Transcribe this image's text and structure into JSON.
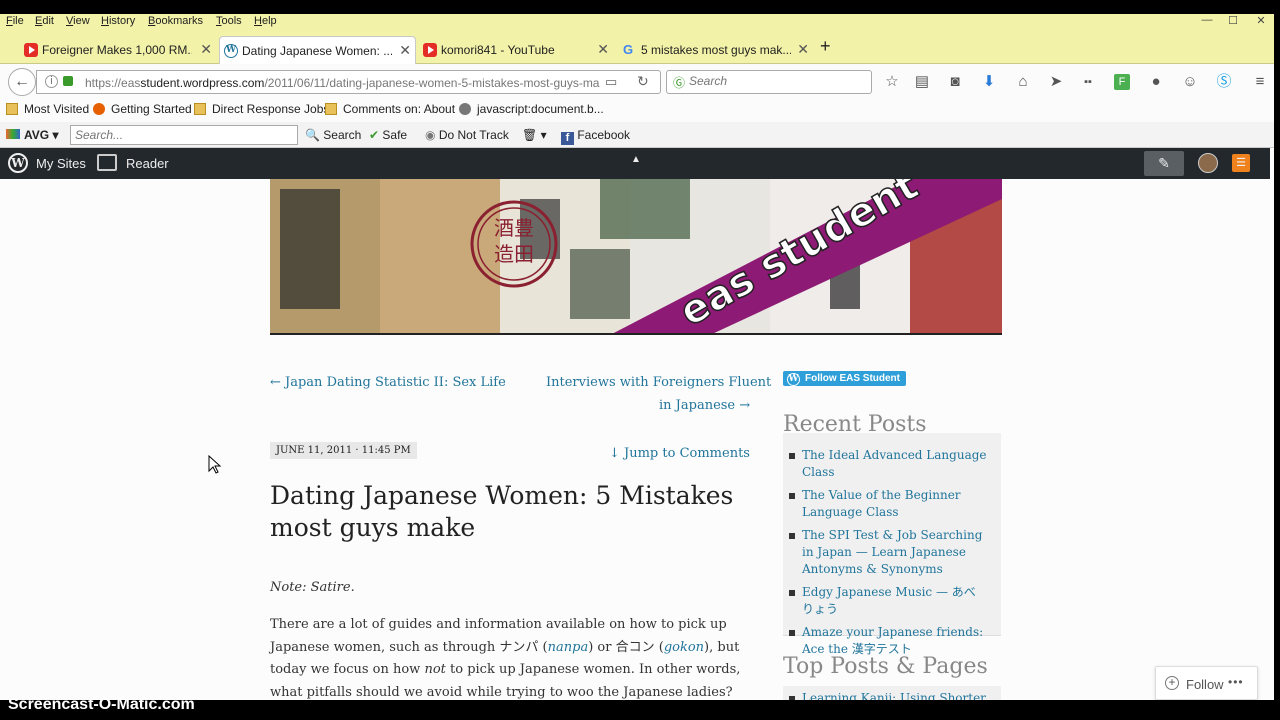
{
  "menu": [
    "File",
    "Edit",
    "View",
    "History",
    "Bookmarks",
    "Tools",
    "Help"
  ],
  "tabs": [
    {
      "label": "Foreigner Makes 1,000 RM...",
      "icon": "youtube-icon"
    },
    {
      "label": "Dating Japanese Women: ...",
      "icon": "wordpress-icon"
    },
    {
      "label": "komori841 - YouTube",
      "icon": "youtube-icon"
    },
    {
      "label": "5 mistakes most guys mak...",
      "icon": "google-icon"
    }
  ],
  "url": {
    "prefix": "https://eas",
    "domain": "student.wordpress.com",
    "path": "/2011/06/11/dating-japanese-women-5-mistakes-most-guys-ma"
  },
  "search_placeholder": "Search",
  "bookmarks": [
    "Most Visited",
    "Getting Started",
    "Direct Response Jobs",
    "Comments on: About",
    "javascript:document.b..."
  ],
  "avg": {
    "brand": "AVG",
    "search_placeholder": "Search...",
    "search_label": "Search",
    "safe": "Safe",
    "dnt": "Do Not Track",
    "facebook": "Facebook"
  },
  "wp_admin": {
    "my_sites": "My Sites",
    "reader": "Reader"
  },
  "header_banner": {
    "text": "eas student",
    "seal": "酒豊造田"
  },
  "post_nav": {
    "prev": "← Japan Dating Statistic II: Sex Life",
    "next_line1": "Interviews with Foreigners Fluent",
    "next_line2": "in Japanese →"
  },
  "post": {
    "date": "JUNE 11, 2011 · 11:45 PM",
    "jump": "↓ Jump to Comments",
    "title": "Dating Japanese Women: 5 Mistakes most guys make",
    "note": "Note: Satire.",
    "p1": "There are a lot of guides and information available on how to pick up Japanese women, such as through ナンパ (",
    "link1": "nanpa",
    "p2": ") or 合コン (",
    "link2": "gokon",
    "p3": "), but today we focus on how ",
    "em": "not",
    "p4": " to pick up Japanese women. In other words, what pitfalls should we avoid while trying to woo the Japanese ladies?"
  },
  "sidebar": {
    "follow_button": "Follow EAS Student",
    "recent_title": "Recent Posts",
    "recent_posts": [
      "The Ideal Advanced Language Class",
      "The Value of the Beginner Language Class",
      "The SPI Test & Job Searching in Japan — Learn Japanese Antonyms & Synonyms",
      "Edgy Japanese Music — あべりょう",
      "Amaze your Japanese friends: Ace the 漢字テスト"
    ],
    "top_title": "Top Posts & Pages",
    "top_posts": [
      "Learning Kanji: Using Shorter"
    ]
  },
  "follow_pill": {
    "label": "Follow",
    "more": "•••"
  },
  "watermark": "Screencast-O-Matic.com",
  "colors": {
    "link": "#21759b",
    "wp_bar": "#23282d",
    "firefox_chrome": "#f2f2a8",
    "follow_blue": "#2e9fd8"
  }
}
